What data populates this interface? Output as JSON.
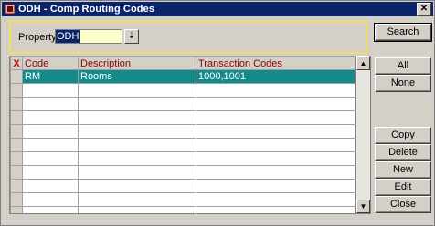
{
  "window": {
    "title": "ODH - Comp Routing Codes"
  },
  "filter": {
    "property_label": "Property",
    "property_value": "ODH"
  },
  "table": {
    "marker_header": "X",
    "columns": [
      "Code",
      "Description",
      "Transaction Codes"
    ],
    "rows": [
      {
        "code": "RM",
        "description": "Rooms",
        "transaction_codes": "1000,1001",
        "selected": true
      }
    ],
    "empty_rows": 10
  },
  "buttons": {
    "search": "Search",
    "all": "All",
    "none": "None",
    "copy": "Copy",
    "delete": "Delete",
    "new": "New",
    "edit": "Edit",
    "close": "Close"
  },
  "colors": {
    "title_bar": "#0a246a",
    "selected_row": "#138b8b",
    "filter_border": "#f0e060",
    "input_bg": "#ffffcc"
  }
}
